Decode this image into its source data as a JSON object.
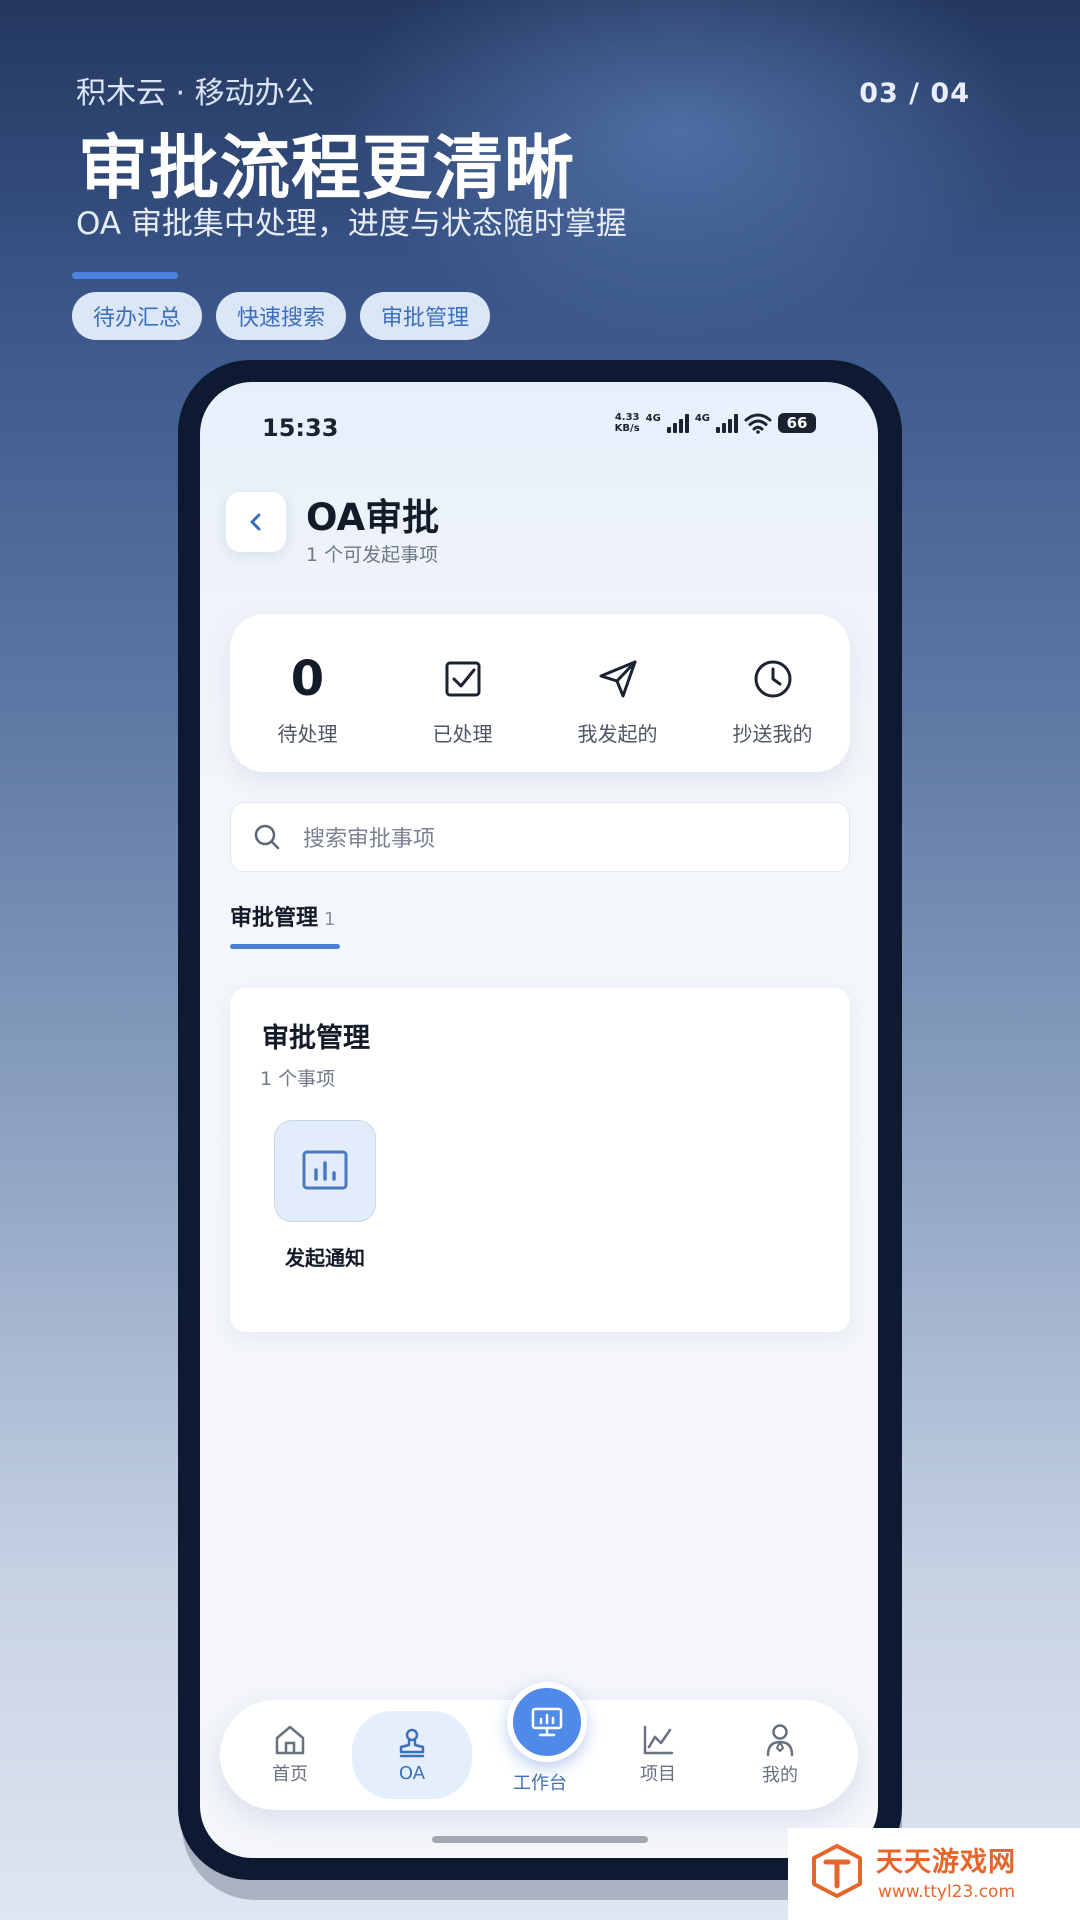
{
  "hero": {
    "brand": "积木云 · 移动办公",
    "page_indicator": "03 / 04",
    "title": "审批流程更清晰",
    "subtitle": "OA 审批集中处理，进度与状态随时掌握",
    "chips": [
      "待办汇总",
      "快速搜索",
      "审批管理"
    ]
  },
  "status_bar": {
    "time": "15:33",
    "net_rate_value": "4.33",
    "net_rate_unit": "KB/s",
    "net_type_1": "4G",
    "net_type_2": "4G",
    "battery": "66"
  },
  "header": {
    "back_icon": "chevron-left-icon",
    "title": "OA审批",
    "subtitle": "1 个可发起事项"
  },
  "stats": {
    "pending": {
      "count": "0",
      "label": "待处理"
    },
    "processed": {
      "label": "已处理",
      "icon": "checkbox-icon"
    },
    "initiated": {
      "label": "我发起的",
      "icon": "send-icon"
    },
    "cc": {
      "label": "抄送我的",
      "icon": "clock-icon"
    }
  },
  "search": {
    "placeholder": "搜索审批事项",
    "icon": "search-icon"
  },
  "tabs": [
    {
      "label": "审批管理",
      "count": "1"
    }
  ],
  "section": {
    "title": "审批管理",
    "subtitle": "1 个事项",
    "items": [
      {
        "label": "发起通知",
        "icon": "chart-icon"
      }
    ]
  },
  "bottom_nav": {
    "items": [
      {
        "label": "首页",
        "icon": "home-icon"
      },
      {
        "label": "OA",
        "icon": "stamp-icon"
      },
      {
        "label": "工作台",
        "icon": "monitor-icon"
      },
      {
        "label": "项目",
        "icon": "line-chart-icon"
      },
      {
        "label": "我的",
        "icon": "user-icon"
      }
    ]
  },
  "watermark": {
    "name": "天天游戏网",
    "url": "www.ttyl23.com"
  },
  "colors": {
    "accent": "#4a7fd6",
    "primary_text": "#141b28",
    "watermark": "#e4662a"
  }
}
